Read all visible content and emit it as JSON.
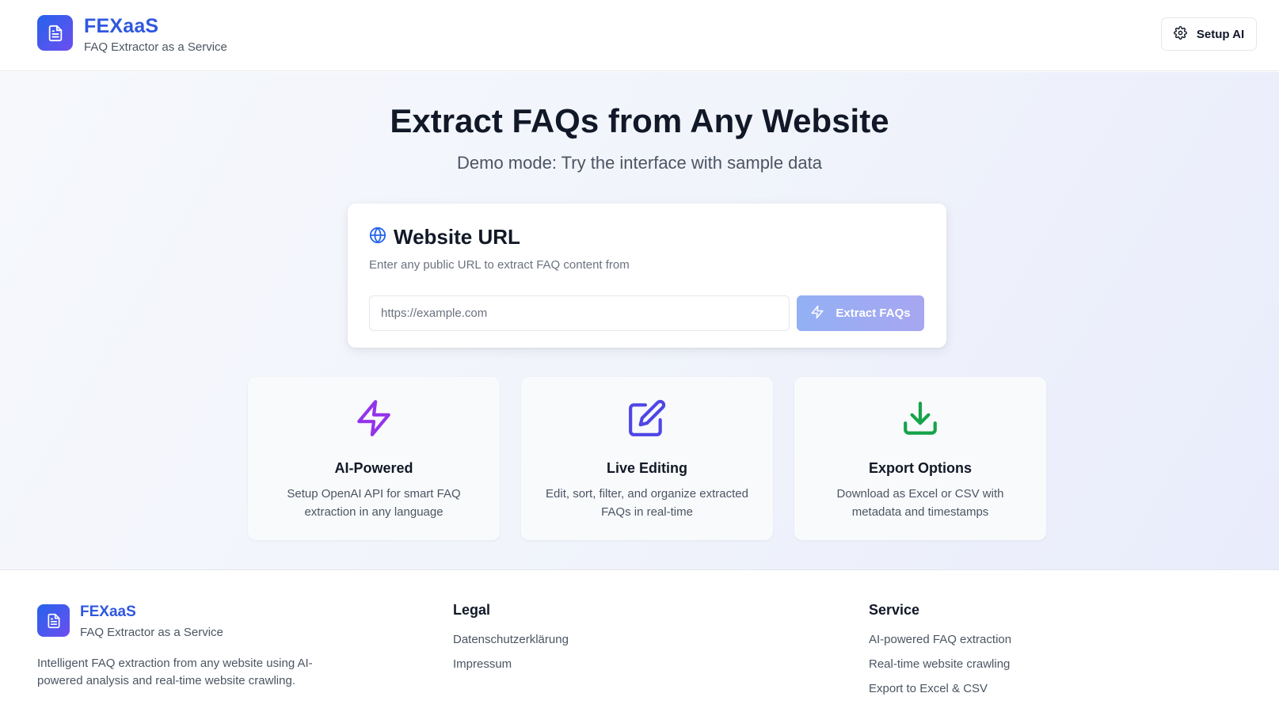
{
  "header": {
    "brand_title": "FEXaaS",
    "brand_subtitle": "FAQ Extractor as a Service",
    "setup_label": "Setup AI"
  },
  "hero": {
    "title": "Extract FAQs from Any Website",
    "subtitle": "Demo mode: Try the interface with sample data"
  },
  "url_card": {
    "title": "Website URL",
    "description": "Enter any public URL to extract FAQ content from",
    "input_placeholder": "https://example.com",
    "input_value": "",
    "button_label": "Extract FAQs"
  },
  "features": [
    {
      "title": "AI-Powered",
      "description": "Setup OpenAI API for smart FAQ extraction in any language",
      "icon": "lightning-icon",
      "color": "#9333ea"
    },
    {
      "title": "Live Editing",
      "description": "Edit, sort, filter, and organize extracted FAQs in real-time",
      "icon": "edit-icon",
      "color": "#4f46e5"
    },
    {
      "title": "Export Options",
      "description": "Download as Excel or CSV with metadata and timestamps",
      "icon": "download-icon",
      "color": "#16a34a"
    }
  ],
  "footer": {
    "brand_title": "FEXaaS",
    "brand_subtitle": "FAQ Extractor as a Service",
    "description": "Intelligent FAQ extraction from any website using AI-powered analysis and real-time website crawling.",
    "legal": {
      "title": "Legal",
      "links": [
        "Datenschutzerklärung",
        "Impressum"
      ]
    },
    "service": {
      "title": "Service",
      "links": [
        "AI-powered FAQ extraction",
        "Real-time website crawling",
        "Export to Excel & CSV"
      ]
    }
  },
  "colors": {
    "brand": "#2f57e0",
    "accent_gradient_start": "#2563eb",
    "accent_gradient_end": "#6d4ef0"
  }
}
